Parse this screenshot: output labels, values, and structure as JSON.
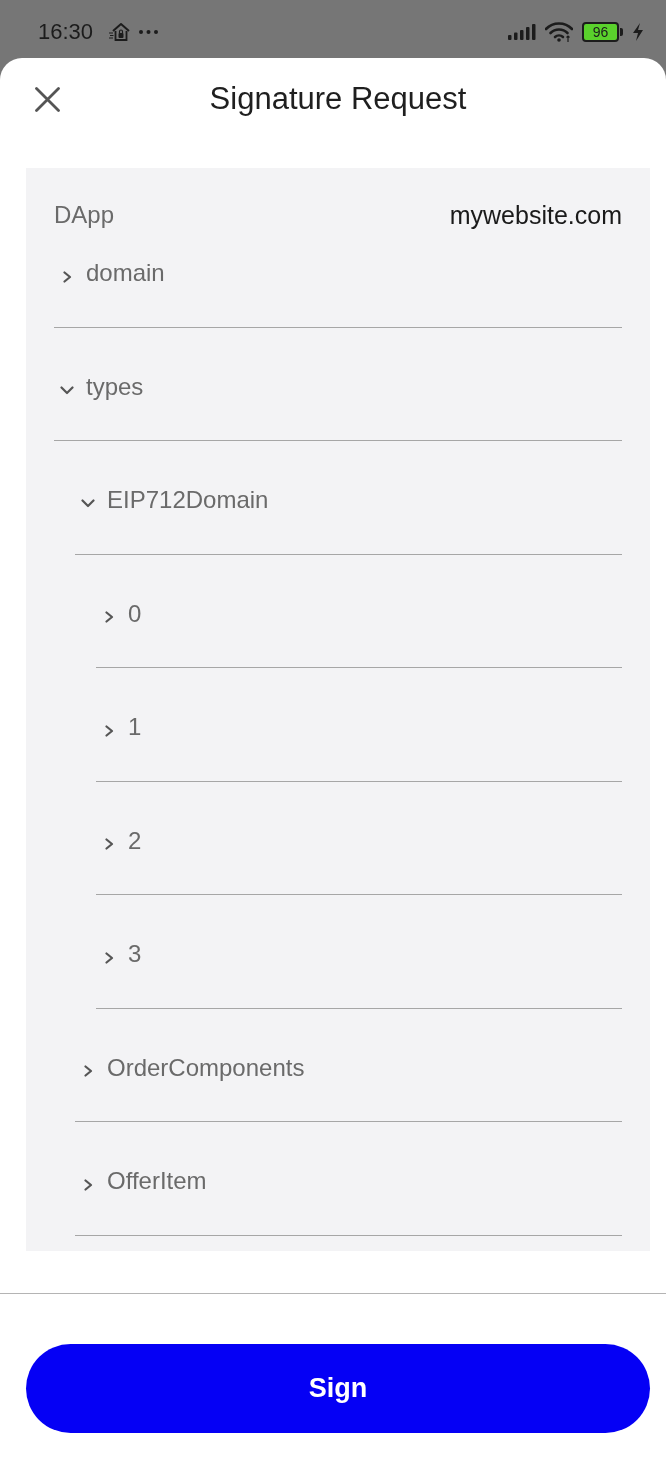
{
  "status_bar": {
    "time": "16:30",
    "battery": "96"
  },
  "header": {
    "title": "Signature Request"
  },
  "details": [
    {
      "label": "DApp",
      "value": "mywebsite.com"
    }
  ],
  "tree": [
    {
      "label": "domain",
      "expanded": false
    },
    {
      "label": "types",
      "expanded": true,
      "children": [
        {
          "label": "EIP712Domain",
          "expanded": true,
          "children": [
            {
              "label": "0",
              "expanded": false
            },
            {
              "label": "1",
              "expanded": false
            },
            {
              "label": "2",
              "expanded": false
            },
            {
              "label": "3",
              "expanded": false
            }
          ]
        },
        {
          "label": "OrderComponents",
          "expanded": false
        },
        {
          "label": "OfferItem",
          "expanded": false
        }
      ]
    }
  ],
  "footer": {
    "sign_button": "Sign"
  }
}
